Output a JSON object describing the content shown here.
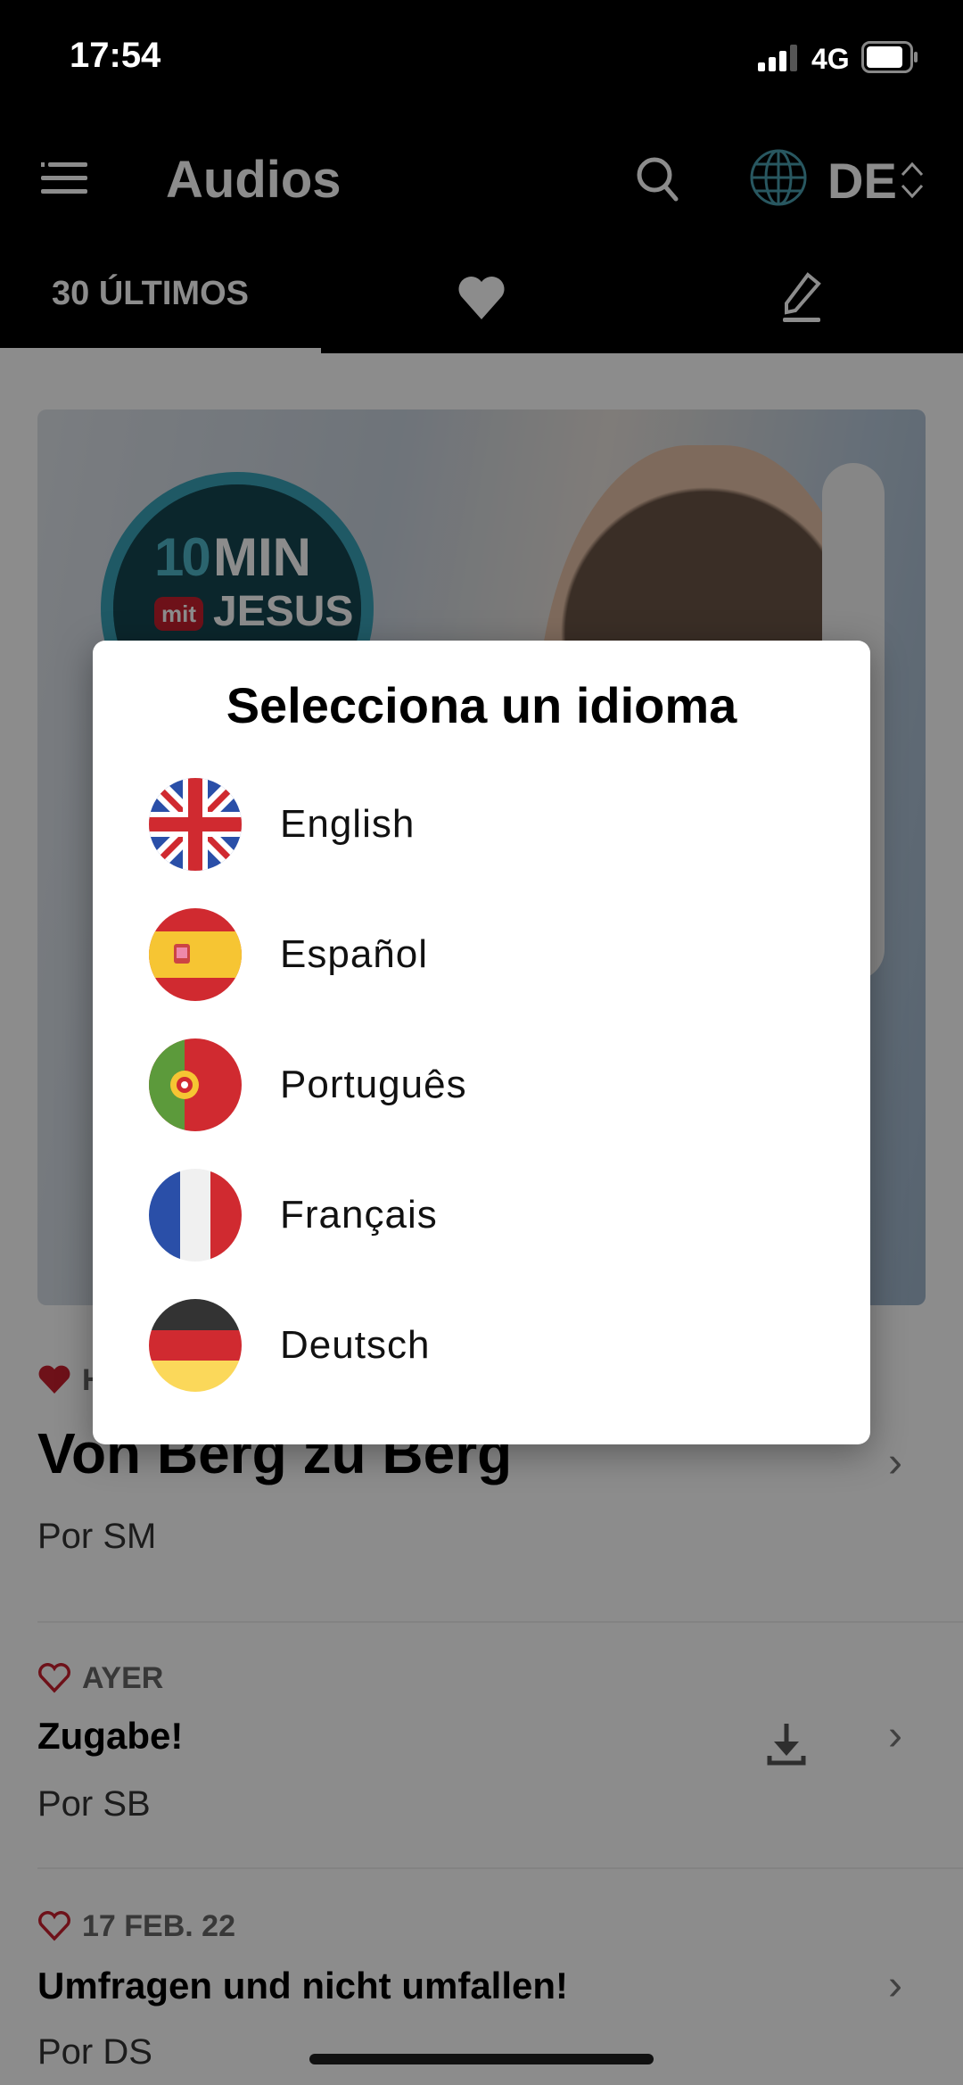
{
  "status_bar": {
    "time": "17:54",
    "network": "4G",
    "battery_level": 0.85
  },
  "header": {
    "title": "Audios",
    "language_code": "DE",
    "icons": [
      "menu-icon",
      "search-icon",
      "globe-icon",
      "chevron-up-down-icon"
    ]
  },
  "tabs": [
    {
      "label": "30 ÚLTIMOS",
      "selected": true
    },
    {
      "icon": "heart-icon"
    },
    {
      "icon": "pencil-icon"
    }
  ],
  "banner": {
    "logo_number": "10",
    "logo_word": "MIN",
    "logo_mit": "mit",
    "logo_name": "JESUS"
  },
  "items": [
    {
      "date": "H",
      "title": "Von Berg zu Berg",
      "author": "Por SM",
      "favorite": true
    },
    {
      "date": "AYER",
      "title": "Zugabe!",
      "author": "Por SB",
      "favorite": false,
      "download": true
    },
    {
      "date": "17 FEB. 22",
      "title": "Umfragen und nicht umfallen!",
      "author": "Por DS",
      "favorite": false
    }
  ],
  "modal": {
    "title": "Selecciona un idioma",
    "languages": [
      {
        "label": "English",
        "flag": "uk-flag"
      },
      {
        "label": "Español",
        "flag": "spain-flag"
      },
      {
        "label": "Português",
        "flag": "portugal-flag"
      },
      {
        "label": "Français",
        "flag": "france-flag"
      },
      {
        "label": "Deutsch",
        "flag": "germany-flag"
      }
    ]
  },
  "colors": {
    "accent_red": "#c8202f",
    "globe": "#4a9fb0",
    "overlay": "rgba(0,0,0,0.45)"
  }
}
